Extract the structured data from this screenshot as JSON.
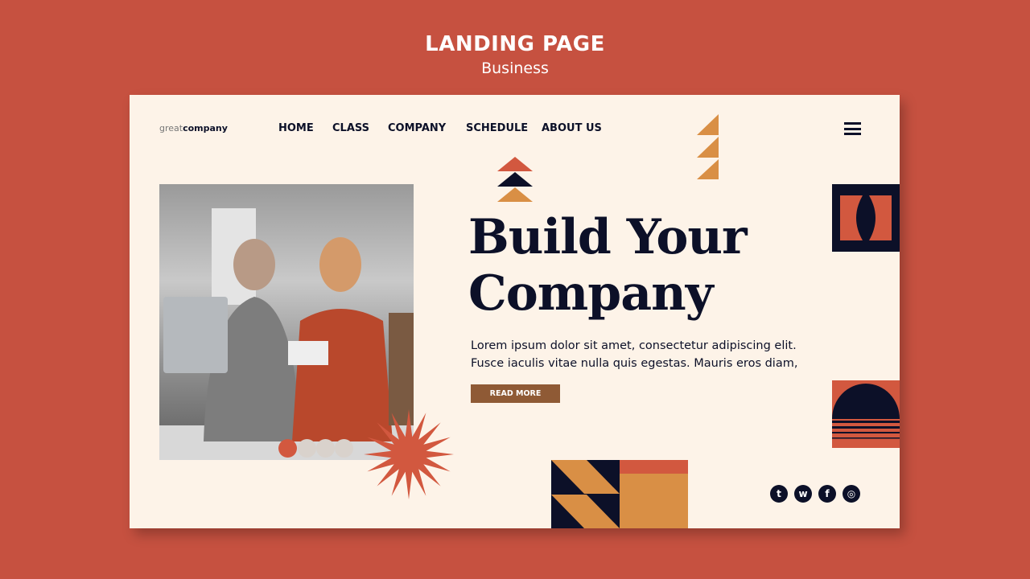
{
  "header": {
    "title": "LANDING PAGE",
    "subtitle": "Business"
  },
  "logo": {
    "light": "great",
    "bold": "company"
  },
  "nav": [
    {
      "label": "HOME"
    },
    {
      "label": "CLASS"
    },
    {
      "label": "COMPANY"
    },
    {
      "label": "SCHEDULE"
    },
    {
      "label": "ABOUT US"
    }
  ],
  "hero": {
    "line1": "Build Your",
    "line2": "Company",
    "para1": "Lorem ipsum dolor sit amet, consectetur adipiscing elit.",
    "para2": "Fusce iaculis vitae nulla quis egestas. Mauris eros diam,",
    "button": "READ MORE"
  },
  "carousel": {
    "active": 1,
    "count": 4
  },
  "social": [
    {
      "icon": "twitter-icon",
      "glyph": "t"
    },
    {
      "icon": "whatsapp-icon",
      "glyph": "w"
    },
    {
      "icon": "facebook-icon",
      "glyph": "f"
    },
    {
      "icon": "instagram-icon",
      "glyph": "◎"
    }
  ],
  "colors": {
    "background": "#c65140",
    "card": "#fdf3e8",
    "navy": "#0c1028",
    "orange": "#d98f45",
    "red": "#d2583f",
    "button": "#8f5a35"
  }
}
